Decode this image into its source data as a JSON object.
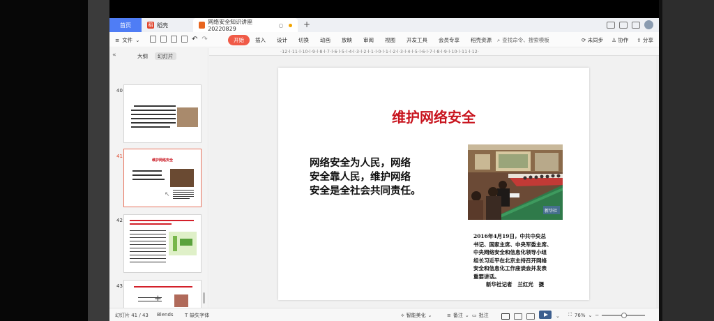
{
  "tabs": {
    "home": "首页",
    "daoke": "稻壳",
    "doc": "网络安全知识讲座20220829"
  },
  "toolbar": {
    "file": "文件",
    "menu": [
      "开始",
      "插入",
      "设计",
      "切换",
      "动画",
      "放映",
      "审阅",
      "视图",
      "开发工具",
      "会员专享",
      "稻壳资源"
    ],
    "active_index": 0,
    "search": "查找命令、搜索模板",
    "unsync": "未同步",
    "collab": "协作",
    "share": "分享"
  },
  "sidebar": {
    "tab_outline": "大纲",
    "tab_slides": "幻灯片",
    "slides": [
      {
        "num": "40"
      },
      {
        "num": "41",
        "title": "维护网络安全",
        "selected": true
      },
      {
        "num": "42"
      },
      {
        "num": "43"
      }
    ]
  },
  "ruler": "·12·l·11·l·10·l·9·l·8·l·7·l·6·l·5·l·4·l·3·l·2·l·1·l·0·l·1·l·2·l·3·l·4·l·5·l·6·l·7·l·8·l·9·l·10·l·11·l·12·",
  "slide": {
    "title": "维护网络安全",
    "body_lines": [
      "网络安全为人民，网络",
      "安全靠人民，维护网络",
      "安全是全社会共同责任。"
    ],
    "caption_lines": [
      "2016年4月19日，中共中央总",
      "书记、国家主席、中央军委主席、",
      "中央网络安全和信息化领导小组",
      "组长习近平在北京主持召开网络",
      "安全和信息化工作座谈会并发表",
      "重要讲话。"
    ],
    "caption_sig": "新华社记者   兰红光   摄",
    "photo_watermark": "新华社"
  },
  "status": {
    "slide_counter": "幻灯片 41 / 43",
    "theme": "Blends",
    "missing_font": "缺失字体",
    "smart_beautify": "智能美化",
    "notes": "备注",
    "comments": "批注",
    "zoom": "76%"
  },
  "colors": {
    "accent": "#f05a47",
    "title_red": "#c8141e",
    "home_tab": "#4f7df5"
  }
}
